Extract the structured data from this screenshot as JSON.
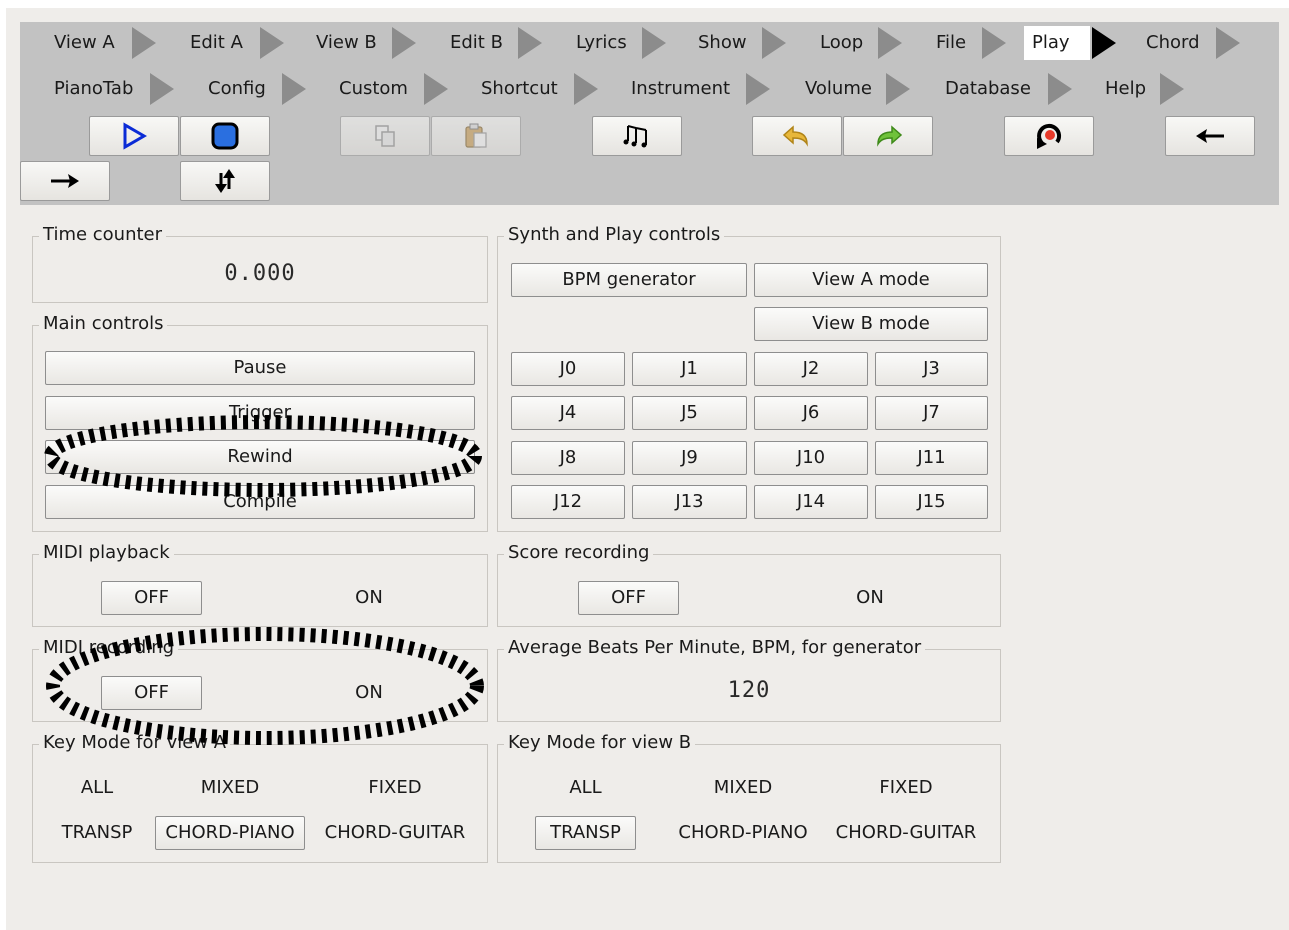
{
  "menu": {
    "row1": [
      "View A",
      "Edit A",
      "View B",
      "Edit B",
      "Lyrics",
      "Show",
      "Loop",
      "File",
      "Play",
      "Chord"
    ],
    "row2": [
      "PianoTab",
      "Config",
      "Custom",
      "Shortcut",
      "Instrument",
      "Volume",
      "Database",
      "Help"
    ],
    "active": "Play"
  },
  "toolbar": {
    "icons": [
      "play-icon",
      "stop-icon",
      "copy-icon",
      "paste-icon",
      "notes-icon",
      "undo-icon",
      "redo-icon",
      "rewind-loop-icon",
      "arrow-left-icon",
      "arrow-right-icon",
      "swap-vertical-icon"
    ],
    "accent_play": "#0a2bd6",
    "undo_color": "#e8b73a",
    "redo_color": "#6fc23a"
  },
  "time_counter": {
    "title": "Time counter",
    "value": "0.000"
  },
  "main_controls": {
    "title": "Main controls",
    "pause": "Pause",
    "trigger": "Trigger",
    "rewind": "Rewind",
    "compile": "Compile"
  },
  "synth": {
    "title": "Synth and Play controls",
    "bpm_generator": "BPM generator",
    "view_a_mode": "View A mode",
    "view_b_mode": "View B mode",
    "jumps": [
      "J0",
      "J1",
      "J2",
      "J3",
      "J4",
      "J5",
      "J6",
      "J7",
      "J8",
      "J9",
      "J10",
      "J11",
      "J12",
      "J13",
      "J14",
      "J15"
    ]
  },
  "midi_playback": {
    "title": "MIDI playback",
    "off": "OFF",
    "on": "ON"
  },
  "score_recording": {
    "title": "Score recording",
    "off": "OFF",
    "on": "ON"
  },
  "midi_recording": {
    "title": "MIDI recording",
    "off": "OFF",
    "on": "ON"
  },
  "avg_bpm": {
    "title": "Average Beats Per Minute, BPM, for generator",
    "value": "120"
  },
  "key_mode_a": {
    "title": "Key Mode for view A",
    "all": "ALL",
    "mixed": "MIXED",
    "fixed": "FIXED",
    "transp": "TRANSP",
    "chord_piano": "CHORD-PIANO",
    "chord_guitar": "CHORD-GUITAR",
    "selected": "CHORD-PIANO"
  },
  "key_mode_b": {
    "title": "Key Mode for view B",
    "all": "ALL",
    "mixed": "MIXED",
    "fixed": "FIXED",
    "transp": "TRANSP",
    "chord_piano": "CHORD-PIANO",
    "chord_guitar": "CHORD-GUITAR",
    "selected": "TRANSP"
  }
}
